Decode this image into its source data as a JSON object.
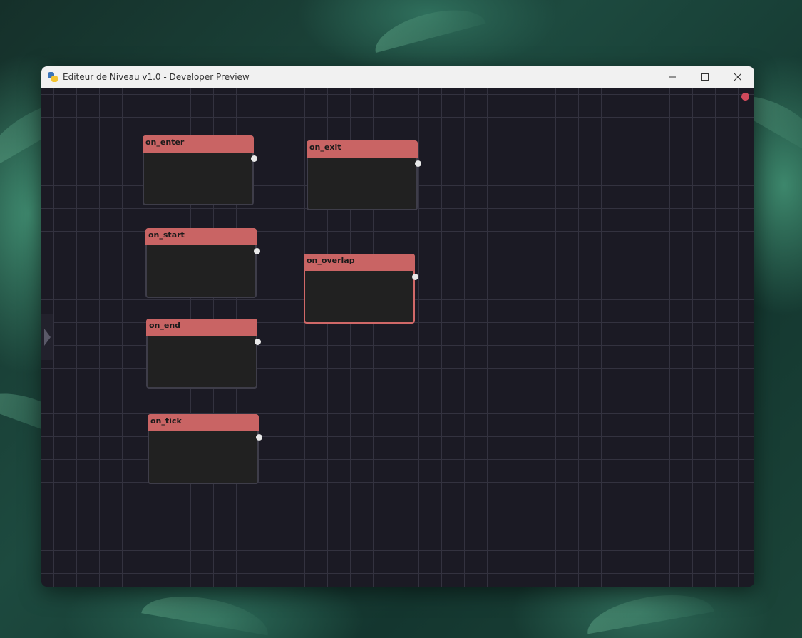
{
  "window": {
    "title": "Editeur de Niveau v1.0 - Developer Preview"
  },
  "controls": {
    "minimize": "—",
    "maximize": "☐",
    "close": "✕"
  },
  "colors": {
    "canvas_bg": "#1b1a24",
    "grid": "#33323f",
    "node_header": "#c96464",
    "node_body": "#212121",
    "status_dot": "#d0495b"
  },
  "nodes": [
    {
      "title": "on_enter"
    },
    {
      "title": "on_exit"
    },
    {
      "title": "on_start"
    },
    {
      "title": "on_overlap",
      "selected": true
    },
    {
      "title": "on_end"
    },
    {
      "title": "on_tick"
    }
  ]
}
